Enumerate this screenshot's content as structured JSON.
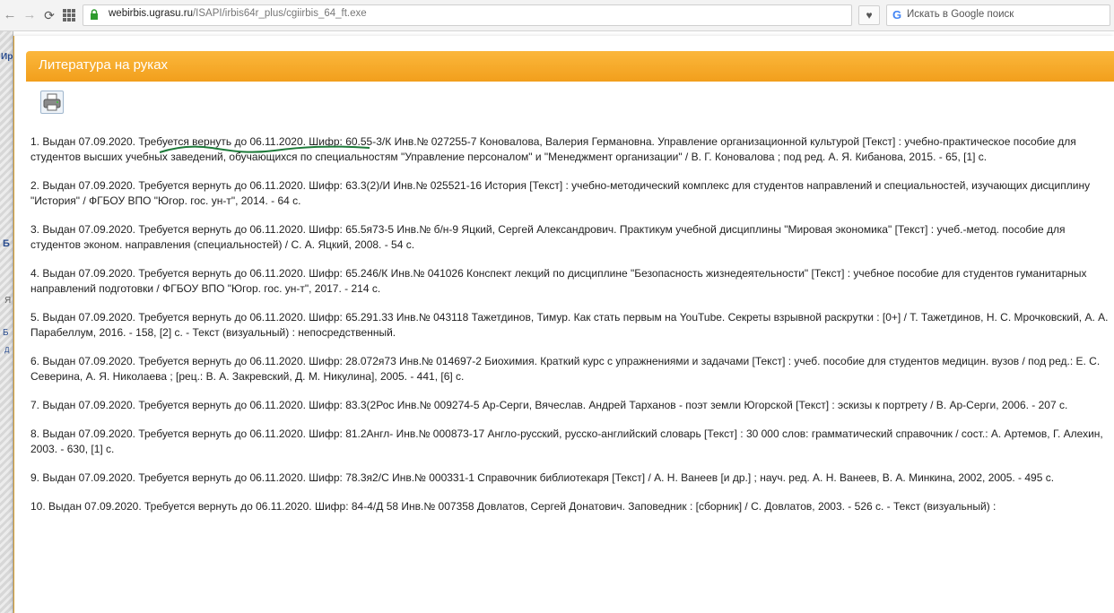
{
  "browser": {
    "url_host": "webirbis.ugrasu.ru",
    "url_path": "/ISAPI/irbis64r_plus/cgiirbis_64_ft.exe",
    "search_placeholder": "Искать в Google поиск",
    "search_engine_letter": "G"
  },
  "background": {
    "fragments": [
      "Ир",
      "Б",
      "Я",
      "Б",
      "Д"
    ]
  },
  "popup": {
    "title": "Литература на руках",
    "header_color": "#f7a82a"
  },
  "items": [
    "1. Выдан 07.09.2020. Требуется вернуть до 06.11.2020. Шифр: 60.55-3/К Инв.№ 027255-7 Коновалова, Валерия Германовна. Управление организационной культурой [Текст] : учебно-практическое пособие для студентов высших учебных заведений, обучающихся по специальностям \"Управление персоналом\" и \"Менеджмент организации\" / В. Г. Коновалова ; под ред. А. Я. Кибанова, 2015. - 65, [1] с.",
    "2. Выдан 07.09.2020. Требуется вернуть до 06.11.2020. Шифр: 63.3(2)/И Инв.№ 025521-16 История [Текст] : учебно-методический комплекс для студентов направлений и специальностей, изучающих дисциплину \"История\" / ФГБОУ ВПО \"Югор. гос. ун-т\", 2014. - 64 с.",
    "3. Выдан 07.09.2020. Требуется вернуть до 06.11.2020. Шифр: 65.5я73-5 Инв.№ б/н-9 Яцкий, Сергей Александрович. Практикум учебной дисциплины \"Мировая экономика\" [Текст] : учеб.-метод. пособие для студентов эконом. направления (специальностей) / С. А. Яцкий, 2008. - 54 с.",
    "4. Выдан 07.09.2020. Требуется вернуть до 06.11.2020. Шифр: 65.246/К Инв.№ 041026 Конспект лекций по дисциплине \"Безопасность жизнедеятельности\" [Текст] : учебное пособие для студентов гуманитарных направлений подготовки / ФГБОУ ВПО \"Югор. гос. ун-т\", 2017. - 214 с.",
    "5. Выдан 07.09.2020. Требуется вернуть до 06.11.2020. Шифр: 65.291.33 Инв.№ 043118 Тажетдинов, Тимур. Как стать первым на YouTube. Секреты взрывной раскрутки : [0+] / Т. Тажетдинов, Н. С. Мрочковский, А. А. Парабеллум, 2016. - 158, [2] с. - Текст (визуальный) : непосредственный.",
    "6. Выдан 07.09.2020. Требуется вернуть до 06.11.2020. Шифр: 28.072я73 Инв.№ 014697-2 Биохимия. Краткий курс с упражнениями и задачами [Текст] : учеб. пособие для студентов медицин. вузов / под ред.: Е. С. Северина, А. Я. Николаева ; [рец.: В. А. Закревский, Д. М. Никулина], 2005. - 441, [6] с.",
    "7. Выдан 07.09.2020. Требуется вернуть до 06.11.2020. Шифр: 83.3(2Рос Инв.№ 009274-5 Ар-Серги, Вячеслав. Андрей Тарханов - поэт земли Югорской [Текст] : эскизы к портрету / В. Ар-Серги, 2006. - 207 с.",
    "8. Выдан 07.09.2020. Требуется вернуть до 06.11.2020. Шифр: 81.2Англ- Инв.№ 000873-17 Англо-русский, русско-английский словарь [Текст] : 30 000 слов: грамматический справочник / сост.: А. Артемов, Г. Алехин, 2003. - 630, [1] с.",
    "9. Выдан 07.09.2020. Требуется вернуть до 06.11.2020. Шифр: 78.3я2/С Инв.№ 000331-1 Справочник библиотекаря [Текст] / А. Н. Ванеев [и др.] ; науч. ред. А. Н. Ванеев, В. А. Минкина, 2002, 2005. - 495 с.",
    "10. Выдан 07.09.2020. Требуется вернуть до 06.11.2020. Шифр: 84-4/Д 58 Инв.№ 007358 Довлатов, Сергей Донатович. Заповедник : [сборник] / С. Довлатов, 2003. - 526 с. - Текст (визуальный) :"
  ],
  "annotation_color": "#1e7a3a"
}
